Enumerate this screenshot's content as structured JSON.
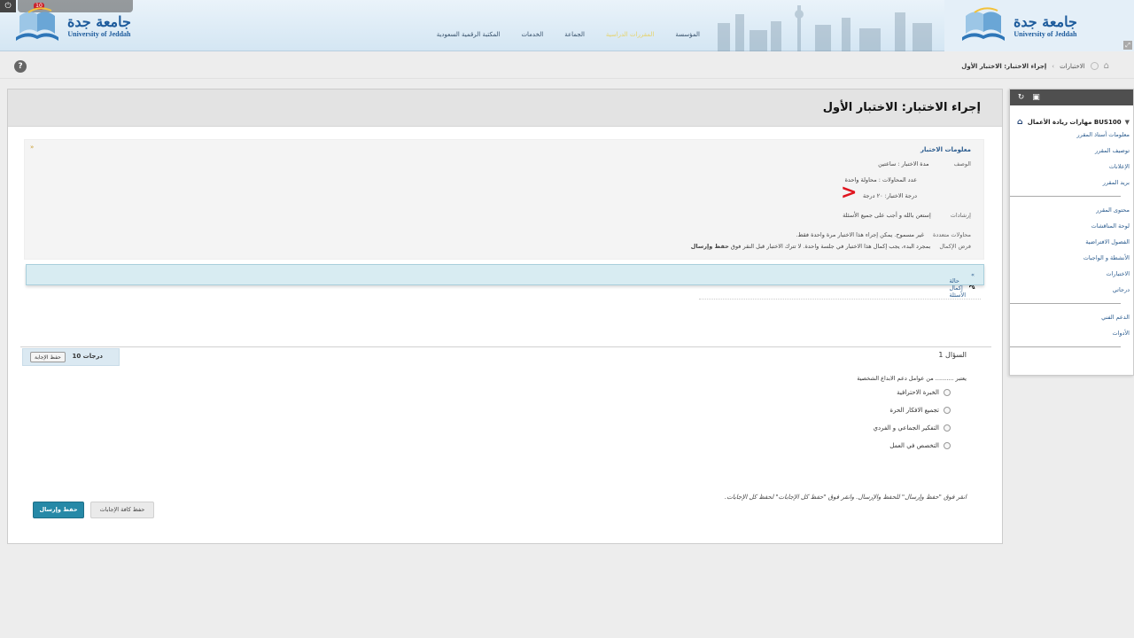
{
  "header": {
    "university_ar": "جامعة جدة",
    "university_en": "University of Jeddah",
    "nav": [
      "المؤسسة",
      "",
      "الجماعة",
      "الخدمات",
      "المكتبة الرقمية السعودية"
    ],
    "user_badge": "10"
  },
  "breadcrumb": {
    "items": [
      "الاختبارات",
      "إجراء الاختبار: الاختبار الأول"
    ]
  },
  "page": {
    "title": "إجراء الاختبار: الاختبار الأول"
  },
  "info": {
    "heading": "معلومات الاختبار",
    "description_label": "الوصف",
    "duration": "مدة الاختبار : ساعتين",
    "attempts": "عدد المحاولات : محاولة واحدة",
    "grade": "درجة الاختبار: ٢٠ درجة",
    "instructions_label": "إرشادات",
    "instructions": "إستعن بالله و أجب على جميع الأسئلة",
    "multi_attempts_label": "محاولات متعددة",
    "multi_attempts": "غير مسموح. يمكن إجراء هذا الاختبار مرة واحدة فقط.",
    "force_label": "فرض الإكمال",
    "force_text": "بمجرد البدء، يجب إكمال هذا الاختبار في جلسة واحدة. لا تترك الاختبار قبل النقر فوق",
    "force_bold": "حفظ وإرسال",
    "marker": ">"
  },
  "status_bar": {
    "label": "حالة إكمال الأسئلة"
  },
  "question": {
    "number_label": "السؤال 1",
    "points": "10 درجات",
    "save_answer": "حفظ الإجابة",
    "text": "يعتبر .......... من عوامل دعم الابداع الشخصية",
    "options": [
      "الخبرة الاحترافية",
      "تجميع الافكار الحرة",
      "التفكير الجماعي و الفردي",
      "التخصص في العمل"
    ]
  },
  "footer": {
    "instruction": "انقر فوق \"حفظ وإرسال\" للحفظ والإرسال. وانقر فوق \"حفظ كل الإجابات\" لحفظ كل الإجابات.",
    "save_submit": "حفظ وإرسال",
    "save_all": "حفظ كافة الإجابات"
  },
  "sidebar": {
    "course": "BUS100 مهارات ريادة الأعمال",
    "group1": [
      "معلومات أستاذ المقرر",
      "توصيف المقرر",
      "الإعلانات",
      "بريد المقرر"
    ],
    "group2": [
      "محتوى المقرر",
      "لوحة المناقشات",
      "الفصول الافتراضية",
      "الأنشطة و الواجبات",
      "الاختبارات",
      "درجاتي"
    ],
    "group3": [
      "الدعم الفني",
      "الأدوات"
    ]
  }
}
